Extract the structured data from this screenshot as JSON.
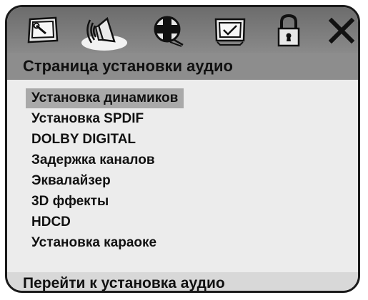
{
  "toolbar": {
    "icons": [
      {
        "name": "general-setup-icon",
        "active": false
      },
      {
        "name": "audio-setup-icon",
        "active": true
      },
      {
        "name": "video-setup-icon",
        "active": false
      },
      {
        "name": "preference-icon",
        "active": false
      },
      {
        "name": "password-lock-icon",
        "active": false
      },
      {
        "name": "close-icon",
        "active": false
      }
    ]
  },
  "header": {
    "title": "Страница установки аудио"
  },
  "menu": {
    "items": [
      {
        "label": "Установка динамиков",
        "selected": true
      },
      {
        "label": "Установка SPDIF",
        "selected": false
      },
      {
        "label": "DOLBY DIGITAL",
        "selected": false
      },
      {
        "label": "Задержка каналов",
        "selected": false
      },
      {
        "label": "Эквалайзер",
        "selected": false
      },
      {
        "label": "3D ффекты",
        "selected": false
      },
      {
        "label": "HDCD",
        "selected": false
      },
      {
        "label": "Установка караоке",
        "selected": false
      }
    ]
  },
  "footer": {
    "hint": "Перейти к установка аудио"
  },
  "colors": {
    "toolbar": "#7a7a7a",
    "header": "#8d8d8d",
    "selected": "#a9a9a9",
    "body": "#ececec"
  }
}
